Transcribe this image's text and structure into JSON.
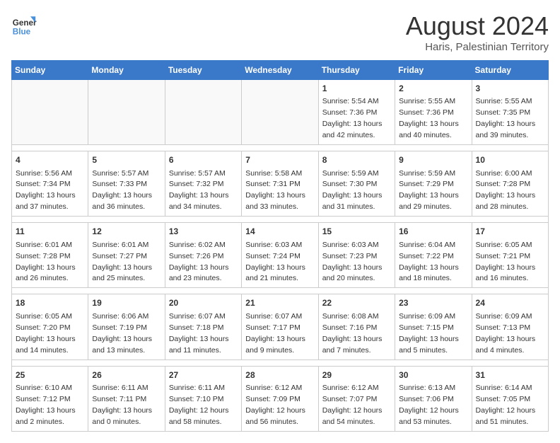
{
  "header": {
    "logo_line1": "General",
    "logo_line2": "Blue",
    "month_year": "August 2024",
    "location": "Haris, Palestinian Territory"
  },
  "days_of_week": [
    "Sunday",
    "Monday",
    "Tuesday",
    "Wednesday",
    "Thursday",
    "Friday",
    "Saturday"
  ],
  "weeks": [
    [
      {
        "day": "",
        "detail": ""
      },
      {
        "day": "",
        "detail": ""
      },
      {
        "day": "",
        "detail": ""
      },
      {
        "day": "",
        "detail": ""
      },
      {
        "day": "1",
        "detail": "Sunrise: 5:54 AM\nSunset: 7:36 PM\nDaylight: 13 hours\nand 42 minutes."
      },
      {
        "day": "2",
        "detail": "Sunrise: 5:55 AM\nSunset: 7:36 PM\nDaylight: 13 hours\nand 40 minutes."
      },
      {
        "day": "3",
        "detail": "Sunrise: 5:55 AM\nSunset: 7:35 PM\nDaylight: 13 hours\nand 39 minutes."
      }
    ],
    [
      {
        "day": "4",
        "detail": "Sunrise: 5:56 AM\nSunset: 7:34 PM\nDaylight: 13 hours\nand 37 minutes."
      },
      {
        "day": "5",
        "detail": "Sunrise: 5:57 AM\nSunset: 7:33 PM\nDaylight: 13 hours\nand 36 minutes."
      },
      {
        "day": "6",
        "detail": "Sunrise: 5:57 AM\nSunset: 7:32 PM\nDaylight: 13 hours\nand 34 minutes."
      },
      {
        "day": "7",
        "detail": "Sunrise: 5:58 AM\nSunset: 7:31 PM\nDaylight: 13 hours\nand 33 minutes."
      },
      {
        "day": "8",
        "detail": "Sunrise: 5:59 AM\nSunset: 7:30 PM\nDaylight: 13 hours\nand 31 minutes."
      },
      {
        "day": "9",
        "detail": "Sunrise: 5:59 AM\nSunset: 7:29 PM\nDaylight: 13 hours\nand 29 minutes."
      },
      {
        "day": "10",
        "detail": "Sunrise: 6:00 AM\nSunset: 7:28 PM\nDaylight: 13 hours\nand 28 minutes."
      }
    ],
    [
      {
        "day": "11",
        "detail": "Sunrise: 6:01 AM\nSunset: 7:28 PM\nDaylight: 13 hours\nand 26 minutes."
      },
      {
        "day": "12",
        "detail": "Sunrise: 6:01 AM\nSunset: 7:27 PM\nDaylight: 13 hours\nand 25 minutes."
      },
      {
        "day": "13",
        "detail": "Sunrise: 6:02 AM\nSunset: 7:26 PM\nDaylight: 13 hours\nand 23 minutes."
      },
      {
        "day": "14",
        "detail": "Sunrise: 6:03 AM\nSunset: 7:24 PM\nDaylight: 13 hours\nand 21 minutes."
      },
      {
        "day": "15",
        "detail": "Sunrise: 6:03 AM\nSunset: 7:23 PM\nDaylight: 13 hours\nand 20 minutes."
      },
      {
        "day": "16",
        "detail": "Sunrise: 6:04 AM\nSunset: 7:22 PM\nDaylight: 13 hours\nand 18 minutes."
      },
      {
        "day": "17",
        "detail": "Sunrise: 6:05 AM\nSunset: 7:21 PM\nDaylight: 13 hours\nand 16 minutes."
      }
    ],
    [
      {
        "day": "18",
        "detail": "Sunrise: 6:05 AM\nSunset: 7:20 PM\nDaylight: 13 hours\nand 14 minutes."
      },
      {
        "day": "19",
        "detail": "Sunrise: 6:06 AM\nSunset: 7:19 PM\nDaylight: 13 hours\nand 13 minutes."
      },
      {
        "day": "20",
        "detail": "Sunrise: 6:07 AM\nSunset: 7:18 PM\nDaylight: 13 hours\nand 11 minutes."
      },
      {
        "day": "21",
        "detail": "Sunrise: 6:07 AM\nSunset: 7:17 PM\nDaylight: 13 hours\nand 9 minutes."
      },
      {
        "day": "22",
        "detail": "Sunrise: 6:08 AM\nSunset: 7:16 PM\nDaylight: 13 hours\nand 7 minutes."
      },
      {
        "day": "23",
        "detail": "Sunrise: 6:09 AM\nSunset: 7:15 PM\nDaylight: 13 hours\nand 5 minutes."
      },
      {
        "day": "24",
        "detail": "Sunrise: 6:09 AM\nSunset: 7:13 PM\nDaylight: 13 hours\nand 4 minutes."
      }
    ],
    [
      {
        "day": "25",
        "detail": "Sunrise: 6:10 AM\nSunset: 7:12 PM\nDaylight: 13 hours\nand 2 minutes."
      },
      {
        "day": "26",
        "detail": "Sunrise: 6:11 AM\nSunset: 7:11 PM\nDaylight: 13 hours\nand 0 minutes."
      },
      {
        "day": "27",
        "detail": "Sunrise: 6:11 AM\nSunset: 7:10 PM\nDaylight: 12 hours\nand 58 minutes."
      },
      {
        "day": "28",
        "detail": "Sunrise: 6:12 AM\nSunset: 7:09 PM\nDaylight: 12 hours\nand 56 minutes."
      },
      {
        "day": "29",
        "detail": "Sunrise: 6:12 AM\nSunset: 7:07 PM\nDaylight: 12 hours\nand 54 minutes."
      },
      {
        "day": "30",
        "detail": "Sunrise: 6:13 AM\nSunset: 7:06 PM\nDaylight: 12 hours\nand 53 minutes."
      },
      {
        "day": "31",
        "detail": "Sunrise: 6:14 AM\nSunset: 7:05 PM\nDaylight: 12 hours\nand 51 minutes."
      }
    ]
  ]
}
